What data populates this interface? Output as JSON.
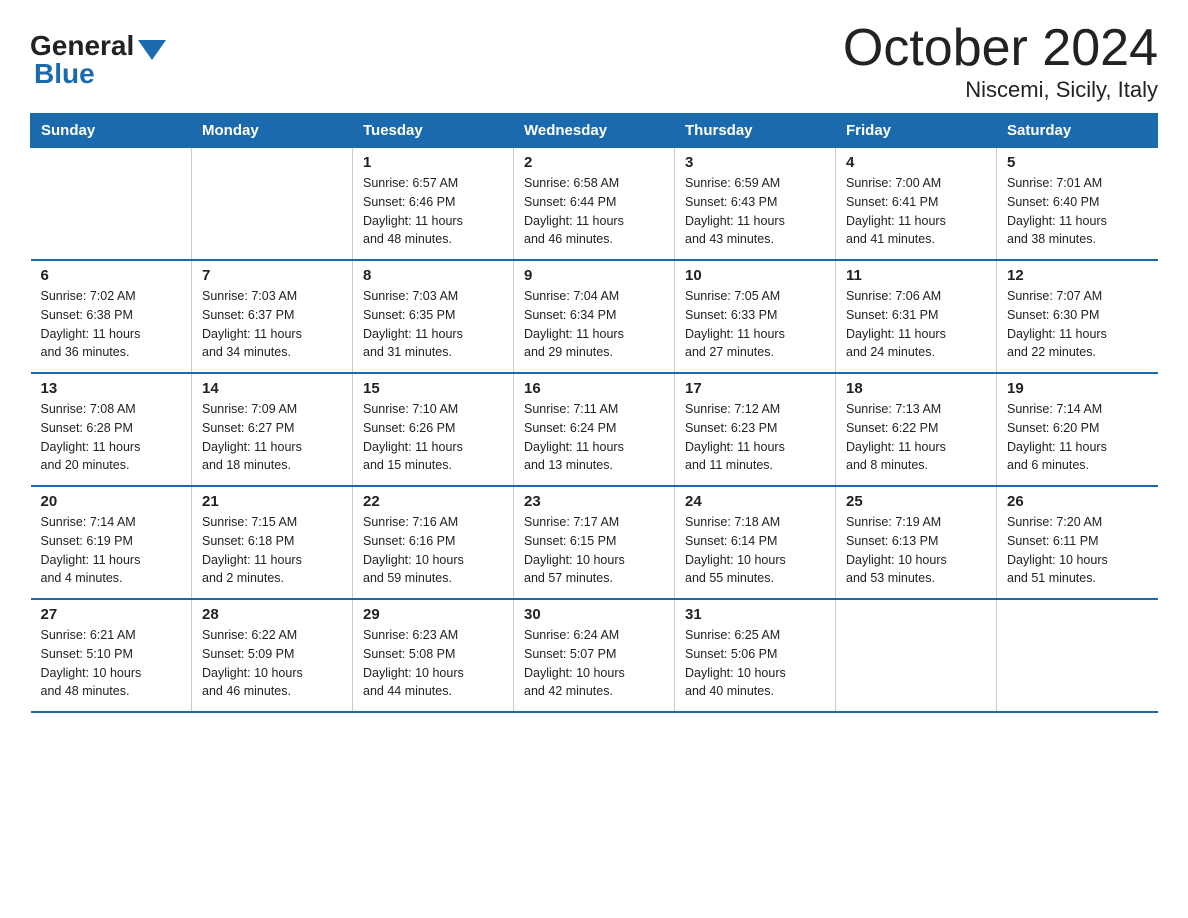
{
  "logo": {
    "general": "General",
    "blue": "Blue",
    "arrow": "▲"
  },
  "title": "October 2024",
  "location": "Niscemi, Sicily, Italy",
  "days_of_week": [
    "Sunday",
    "Monday",
    "Tuesday",
    "Wednesday",
    "Thursday",
    "Friday",
    "Saturday"
  ],
  "weeks": [
    [
      {
        "day": "",
        "info": ""
      },
      {
        "day": "",
        "info": ""
      },
      {
        "day": "1",
        "info": "Sunrise: 6:57 AM\nSunset: 6:46 PM\nDaylight: 11 hours\nand 48 minutes."
      },
      {
        "day": "2",
        "info": "Sunrise: 6:58 AM\nSunset: 6:44 PM\nDaylight: 11 hours\nand 46 minutes."
      },
      {
        "day": "3",
        "info": "Sunrise: 6:59 AM\nSunset: 6:43 PM\nDaylight: 11 hours\nand 43 minutes."
      },
      {
        "day": "4",
        "info": "Sunrise: 7:00 AM\nSunset: 6:41 PM\nDaylight: 11 hours\nand 41 minutes."
      },
      {
        "day": "5",
        "info": "Sunrise: 7:01 AM\nSunset: 6:40 PM\nDaylight: 11 hours\nand 38 minutes."
      }
    ],
    [
      {
        "day": "6",
        "info": "Sunrise: 7:02 AM\nSunset: 6:38 PM\nDaylight: 11 hours\nand 36 minutes."
      },
      {
        "day": "7",
        "info": "Sunrise: 7:03 AM\nSunset: 6:37 PM\nDaylight: 11 hours\nand 34 minutes."
      },
      {
        "day": "8",
        "info": "Sunrise: 7:03 AM\nSunset: 6:35 PM\nDaylight: 11 hours\nand 31 minutes."
      },
      {
        "day": "9",
        "info": "Sunrise: 7:04 AM\nSunset: 6:34 PM\nDaylight: 11 hours\nand 29 minutes."
      },
      {
        "day": "10",
        "info": "Sunrise: 7:05 AM\nSunset: 6:33 PM\nDaylight: 11 hours\nand 27 minutes."
      },
      {
        "day": "11",
        "info": "Sunrise: 7:06 AM\nSunset: 6:31 PM\nDaylight: 11 hours\nand 24 minutes."
      },
      {
        "day": "12",
        "info": "Sunrise: 7:07 AM\nSunset: 6:30 PM\nDaylight: 11 hours\nand 22 minutes."
      }
    ],
    [
      {
        "day": "13",
        "info": "Sunrise: 7:08 AM\nSunset: 6:28 PM\nDaylight: 11 hours\nand 20 minutes."
      },
      {
        "day": "14",
        "info": "Sunrise: 7:09 AM\nSunset: 6:27 PM\nDaylight: 11 hours\nand 18 minutes."
      },
      {
        "day": "15",
        "info": "Sunrise: 7:10 AM\nSunset: 6:26 PM\nDaylight: 11 hours\nand 15 minutes."
      },
      {
        "day": "16",
        "info": "Sunrise: 7:11 AM\nSunset: 6:24 PM\nDaylight: 11 hours\nand 13 minutes."
      },
      {
        "day": "17",
        "info": "Sunrise: 7:12 AM\nSunset: 6:23 PM\nDaylight: 11 hours\nand 11 minutes."
      },
      {
        "day": "18",
        "info": "Sunrise: 7:13 AM\nSunset: 6:22 PM\nDaylight: 11 hours\nand 8 minutes."
      },
      {
        "day": "19",
        "info": "Sunrise: 7:14 AM\nSunset: 6:20 PM\nDaylight: 11 hours\nand 6 minutes."
      }
    ],
    [
      {
        "day": "20",
        "info": "Sunrise: 7:14 AM\nSunset: 6:19 PM\nDaylight: 11 hours\nand 4 minutes."
      },
      {
        "day": "21",
        "info": "Sunrise: 7:15 AM\nSunset: 6:18 PM\nDaylight: 11 hours\nand 2 minutes."
      },
      {
        "day": "22",
        "info": "Sunrise: 7:16 AM\nSunset: 6:16 PM\nDaylight: 10 hours\nand 59 minutes."
      },
      {
        "day": "23",
        "info": "Sunrise: 7:17 AM\nSunset: 6:15 PM\nDaylight: 10 hours\nand 57 minutes."
      },
      {
        "day": "24",
        "info": "Sunrise: 7:18 AM\nSunset: 6:14 PM\nDaylight: 10 hours\nand 55 minutes."
      },
      {
        "day": "25",
        "info": "Sunrise: 7:19 AM\nSunset: 6:13 PM\nDaylight: 10 hours\nand 53 minutes."
      },
      {
        "day": "26",
        "info": "Sunrise: 7:20 AM\nSunset: 6:11 PM\nDaylight: 10 hours\nand 51 minutes."
      }
    ],
    [
      {
        "day": "27",
        "info": "Sunrise: 6:21 AM\nSunset: 5:10 PM\nDaylight: 10 hours\nand 48 minutes."
      },
      {
        "day": "28",
        "info": "Sunrise: 6:22 AM\nSunset: 5:09 PM\nDaylight: 10 hours\nand 46 minutes."
      },
      {
        "day": "29",
        "info": "Sunrise: 6:23 AM\nSunset: 5:08 PM\nDaylight: 10 hours\nand 44 minutes."
      },
      {
        "day": "30",
        "info": "Sunrise: 6:24 AM\nSunset: 5:07 PM\nDaylight: 10 hours\nand 42 minutes."
      },
      {
        "day": "31",
        "info": "Sunrise: 6:25 AM\nSunset: 5:06 PM\nDaylight: 10 hours\nand 40 minutes."
      },
      {
        "day": "",
        "info": ""
      },
      {
        "day": "",
        "info": ""
      }
    ]
  ]
}
